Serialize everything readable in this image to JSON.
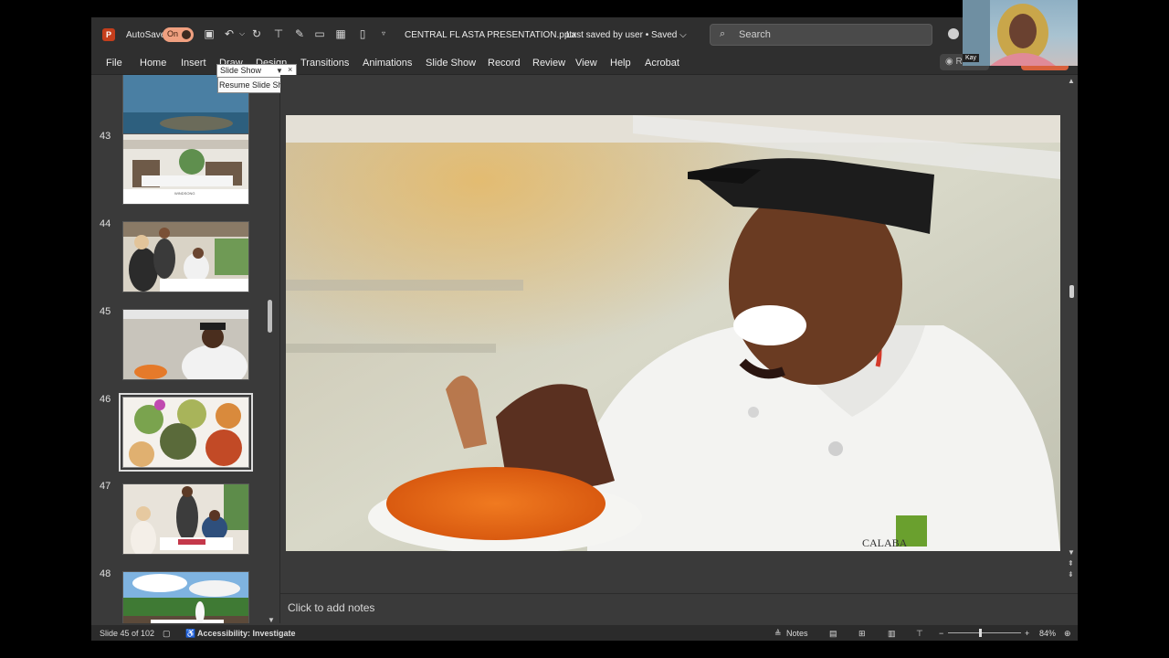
{
  "titlebar": {
    "app_logo": "P",
    "autosave_label": "AutoSave",
    "autosave_state": "On",
    "doc_title": "CENTRAL FL ASTA PRESENTATION.pptx",
    "doc_status": "Last saved by user • Saved ⌵",
    "search_placeholder": "Search",
    "icons": [
      "save-icon",
      "undo-icon",
      "redo-icon",
      "present-icon",
      "format-icon",
      "open-icon",
      "photo-icon",
      "new-icon",
      "more-icon"
    ]
  },
  "ribbon": {
    "tabs": [
      "File",
      "Home",
      "Insert",
      "Draw",
      "Design",
      "Transitions",
      "Animations",
      "Slide Show",
      "Record",
      "Review",
      "View",
      "Help",
      "Acrobat"
    ],
    "record_label": "Re",
    "share_label": "Share"
  },
  "popup": {
    "title": "Slide Show",
    "tooltip": "Resume Slide Show"
  },
  "thumbnails": [
    {
      "num": "",
      "caption": ""
    },
    {
      "num": "43",
      "caption": "WINDSONG"
    },
    {
      "num": "44",
      "caption": ""
    },
    {
      "num": "45",
      "caption": ""
    },
    {
      "num": "46",
      "caption": ""
    },
    {
      "num": "47",
      "caption": ""
    },
    {
      "num": "48",
      "caption": ""
    }
  ],
  "slide": {
    "logo_text": "CALABA"
  },
  "notes": {
    "placeholder": "Click to add notes"
  },
  "statusbar": {
    "slide_count": "Slide 45 of 102",
    "accessibility": "Accessibility: Investigate",
    "notes_label": "Notes",
    "zoom_level": "84%"
  },
  "webcam": {
    "participant_name": "Kay"
  },
  "colors": {
    "accent": "#c43e1c",
    "share": "#d8603c",
    "background": "#3a3a3a"
  }
}
